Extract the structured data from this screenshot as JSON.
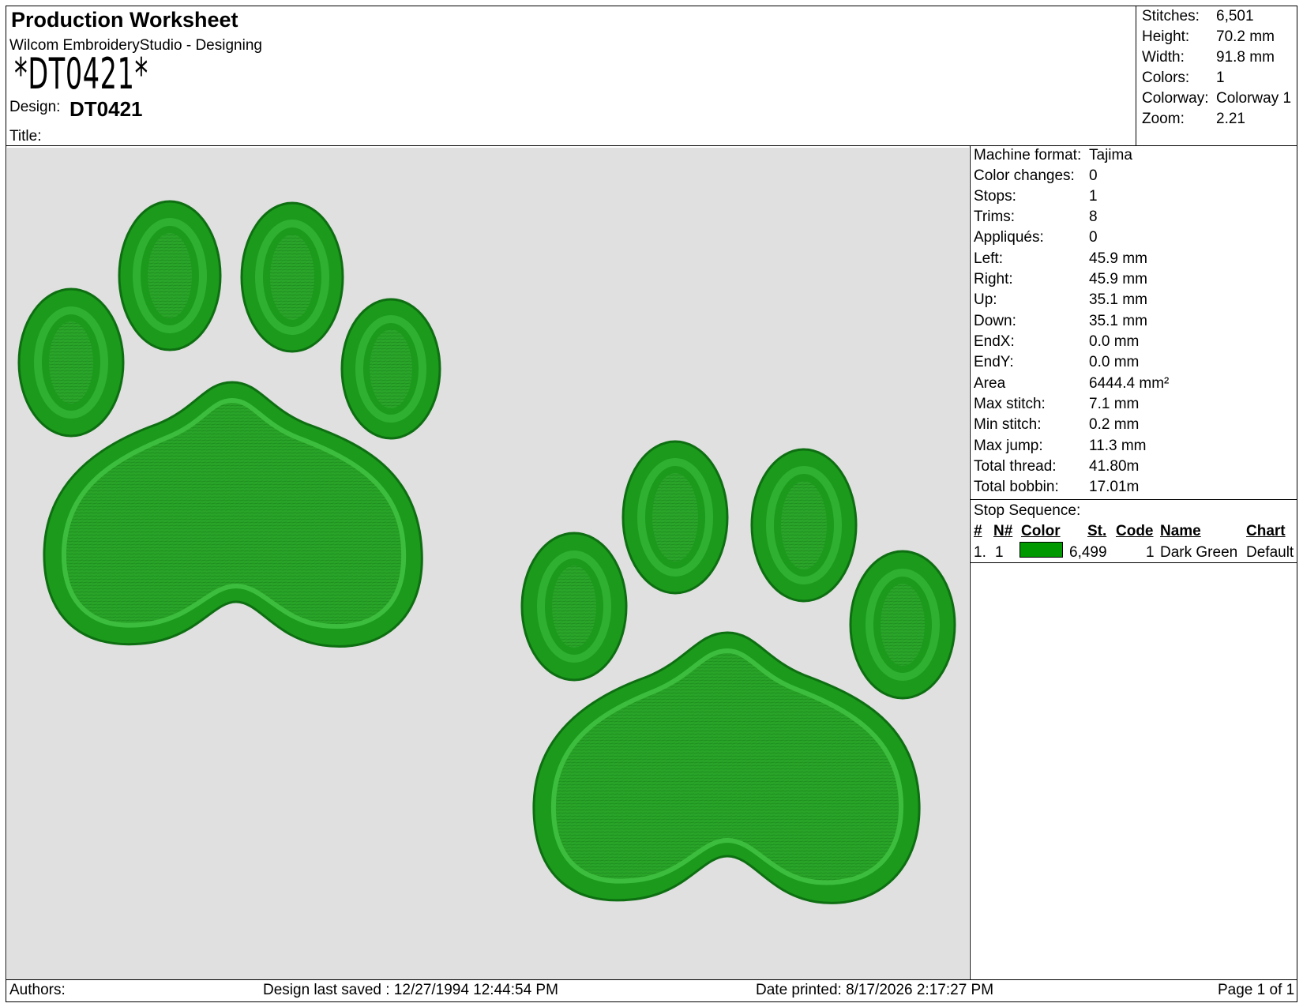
{
  "header": {
    "title": "Production Worksheet",
    "app": "Wilcom EmbroideryStudio - Designing",
    "barcode_text": "*DT0421*",
    "design_label": "Design:",
    "design_value": "DT0421",
    "title_label": "Title:"
  },
  "summary": [
    {
      "label": "Stitches:",
      "value": "6,501"
    },
    {
      "label": "Height:",
      "value": "70.2 mm"
    },
    {
      "label": "Width:",
      "value": "91.8 mm"
    },
    {
      "label": "Colors:",
      "value": "1"
    },
    {
      "label": "Colorway:",
      "value": "Colorway 1"
    },
    {
      "label": "Zoom:",
      "value": "2.21"
    }
  ],
  "machine_info": [
    {
      "label": "Machine format:",
      "value": "Tajima"
    },
    {
      "label": "Color changes:",
      "value": "0"
    },
    {
      "label": "Stops:",
      "value": "1"
    },
    {
      "label": "Trims:",
      "value": "8"
    },
    {
      "label": "Appliqués:",
      "value": "0"
    },
    {
      "label": "Left:",
      "value": "45.9 mm"
    },
    {
      "label": "Right:",
      "value": "45.9 mm"
    },
    {
      "label": "Up:",
      "value": "35.1 mm"
    },
    {
      "label": "Down:",
      "value": "35.1 mm"
    },
    {
      "label": "EndX:",
      "value": "0.0 mm"
    },
    {
      "label": "EndY:",
      "value": "0.0 mm"
    },
    {
      "label": "Area",
      "value": "6444.4 mm²"
    },
    {
      "label": "Max stitch:",
      "value": "7.1 mm"
    },
    {
      "label": "Min stitch:",
      "value": "0.2 mm"
    },
    {
      "label": "Max jump:",
      "value": "11.3 mm"
    },
    {
      "label": "Total thread:",
      "value": "41.80m"
    },
    {
      "label": "Total bobbin:",
      "value": "17.01m"
    }
  ],
  "stop_sequence": {
    "title": "Stop Sequence:",
    "headers": {
      "num": "#",
      "n": "N#",
      "color": "Color",
      "st": "St.",
      "code": "Code",
      "name": "Name",
      "chart": "Chart"
    },
    "rows": [
      {
        "num": "1.",
        "n": "1",
        "color": "#009900",
        "st": "6,499",
        "code": "1",
        "name": "Dark Green",
        "chart": "Default"
      }
    ]
  },
  "design_colors": {
    "thread": "#1f9a1f",
    "thread_light": "#3fbf3f",
    "thread_dark": "#0e6f12",
    "background": "#e0e0e0"
  },
  "footer": {
    "authors": "Authors:",
    "saved": "Design last saved : 12/27/1994 12:44:54 PM",
    "printed": "Date printed: 8/17/2026 2:17:27 PM",
    "page": "Page 1 of 1"
  }
}
